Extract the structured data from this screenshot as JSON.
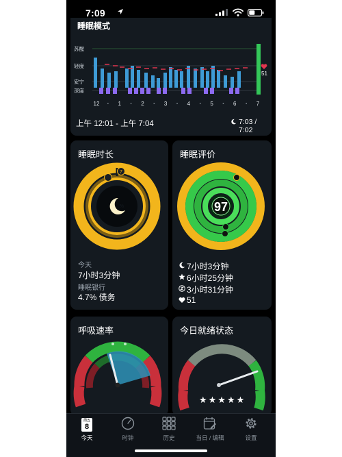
{
  "status_bar": {
    "time": "7:09"
  },
  "sleep_chart": {
    "title": "睡眠模式",
    "stage_labels": [
      "苏醒",
      "轻度",
      "安宁",
      "深度"
    ],
    "hour_ticks": [
      "12",
      "1",
      "2",
      "3",
      "4",
      "5",
      "6",
      "7"
    ],
    "heart_rate": "51",
    "time_range": "上午 12:01 - 上午 7:04",
    "bed_time": "7:03 / 7:02"
  },
  "duration_card": {
    "title": "睡眠时长",
    "ring_marker": "7",
    "center_symbol": "%",
    "today_label": "今天",
    "today_value": "7小时3分钟",
    "bank_label": "睡眠银行",
    "bank_value": "4.7% 债务"
  },
  "rating_card": {
    "title": "睡眠评价",
    "score": "97",
    "lines": [
      "7小时3分钟",
      "6小时25分钟",
      "3小时31分钟",
      "51"
    ]
  },
  "resp_card": {
    "title": "呼吸速率"
  },
  "ready_card": {
    "title": "今日就绪状态",
    "stars": "★★★★★"
  },
  "tabs": [
    {
      "label": "今天",
      "badge_day": "周五",
      "badge_num": "8"
    },
    {
      "label": "时钟"
    },
    {
      "label": "历史"
    },
    {
      "label": "当日 / 编辑"
    },
    {
      "label": "设置"
    }
  ],
  "colors": {
    "accent_yellow": "#f2b51c",
    "ring_green": "#36c94a",
    "deep_purple": "#8d6bf0",
    "bar_blue": "#3e9bd6",
    "hr_red": "#e2354f",
    "awake_green": "#34c759"
  }
}
